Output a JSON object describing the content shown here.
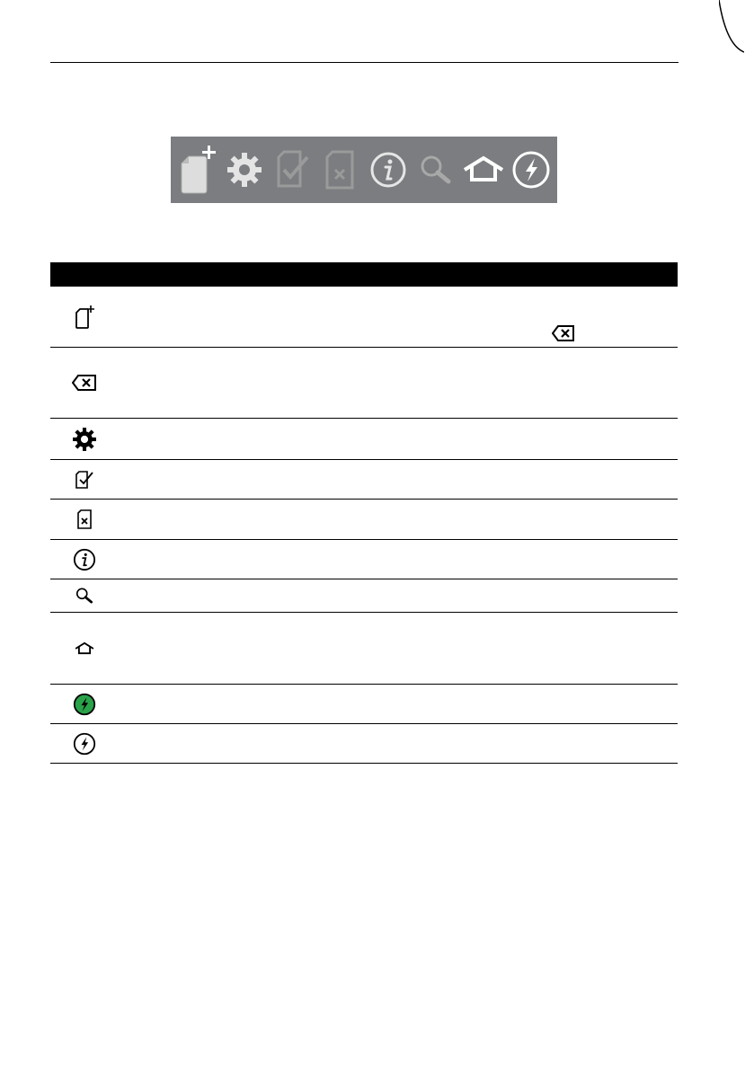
{
  "page": {
    "header_rule": true
  },
  "toolbar": {
    "buttons": [
      {
        "name": "new-file",
        "icon": "file-plus-icon",
        "state": "enabled"
      },
      {
        "name": "settings",
        "icon": "gear-icon",
        "state": "enabled"
      },
      {
        "name": "check",
        "icon": "file-check-icon",
        "state": "disabled"
      },
      {
        "name": "delete-file",
        "icon": "file-x-icon",
        "state": "disabled"
      },
      {
        "name": "info",
        "icon": "info-icon",
        "state": "enabled"
      },
      {
        "name": "search",
        "icon": "magnifier-icon",
        "state": "disabled"
      },
      {
        "name": "home",
        "icon": "house-icon",
        "state": "enabled"
      },
      {
        "name": "power",
        "icon": "lightning-circle-icon",
        "state": "enabled"
      }
    ],
    "colors": {
      "background": "#7b7d80",
      "enabled": "#e6e6e6",
      "disabled": "#9a9a9a"
    }
  },
  "icon_table": {
    "rows": [
      {
        "icon": "file-plus-icon",
        "inline_icon": "backspace-x-icon"
      },
      {
        "icon": "backspace-x-icon"
      },
      {
        "icon": "gear-icon"
      },
      {
        "icon": "file-check-icon"
      },
      {
        "icon": "file-x-icon"
      },
      {
        "icon": "info-icon"
      },
      {
        "icon": "magnifier-icon"
      },
      {
        "icon": "house-icon"
      },
      {
        "icon": "lightning-circle-green-icon",
        "color": "#2aa24a"
      },
      {
        "icon": "lightning-circle-icon"
      }
    ]
  }
}
